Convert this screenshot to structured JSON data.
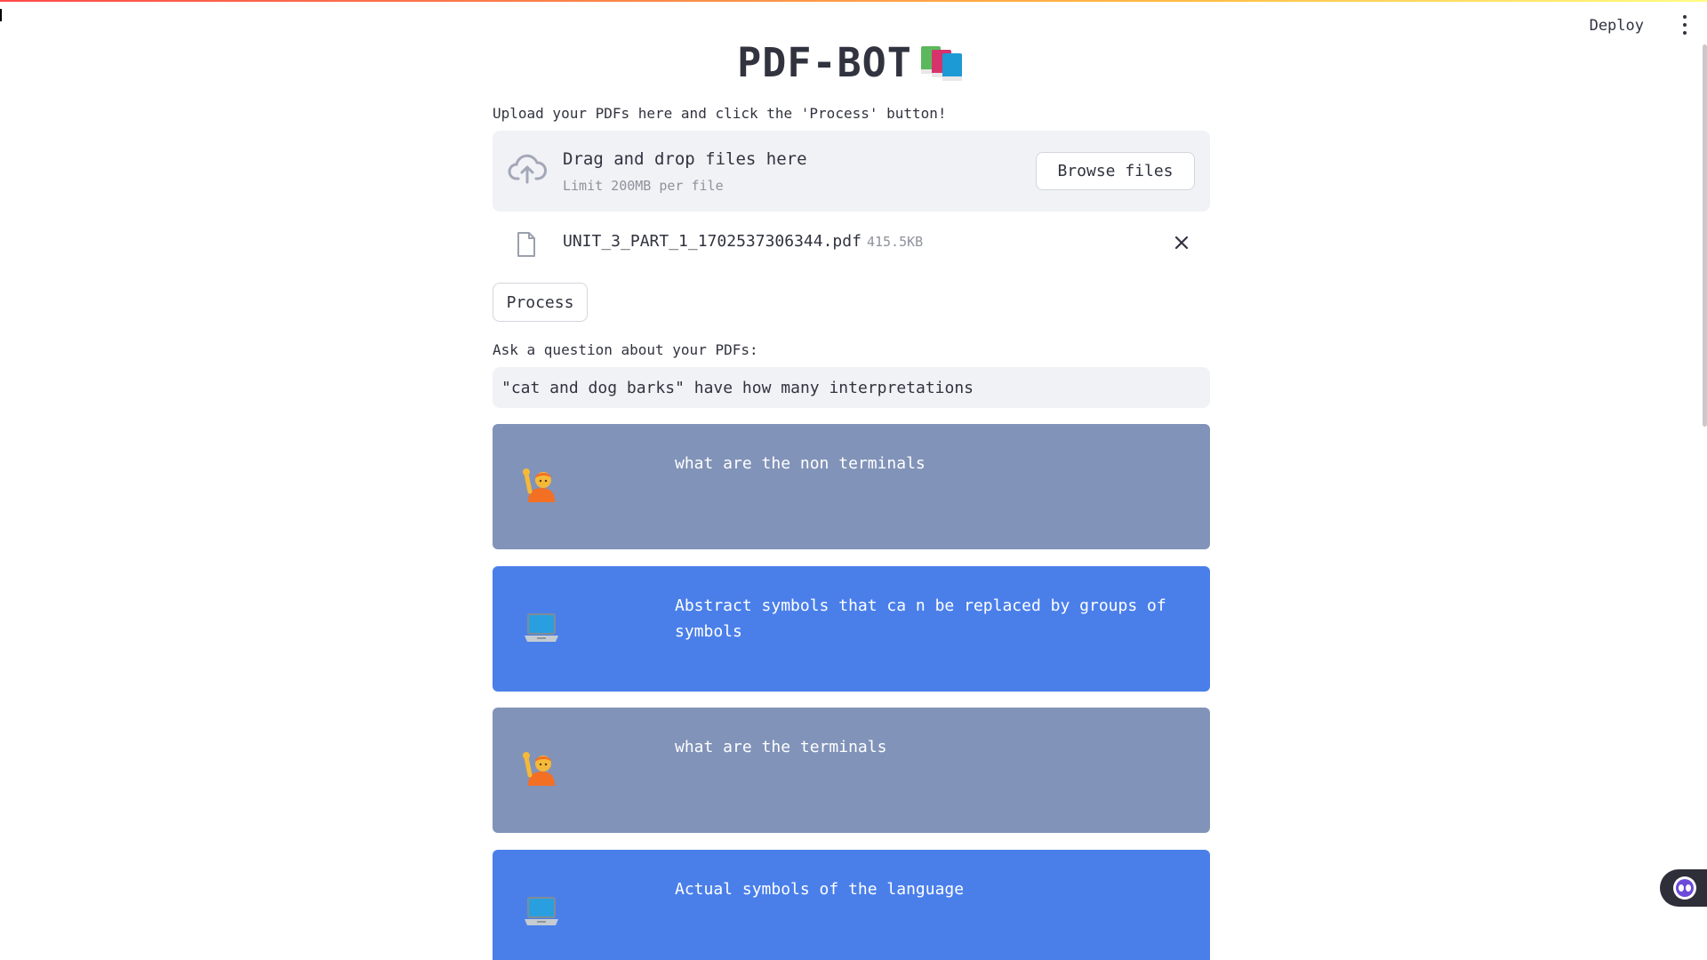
{
  "header": {
    "deploy_label": "Deploy"
  },
  "app": {
    "title": "PDF-BOT",
    "upload_label": "Upload your PDFs here and click the 'Process' button!",
    "dropzone": {
      "title": "Drag and drop files here",
      "limit": "Limit 200MB per file",
      "browse_label": "Browse files"
    },
    "file": {
      "name": "UNIT_3_PART_1_1702537306344.pdf",
      "size": "415.5KB"
    },
    "process_label": "Process",
    "question_label": "Ask a question about your PDFs:",
    "question_value": "\"cat and dog barks\" have how many interpretations"
  },
  "chat": [
    {
      "role": "user",
      "avatar_icon": "person-raising-hand-icon",
      "text": "what are the non terminals"
    },
    {
      "role": "bot",
      "avatar_icon": "laptop-icon",
      "text": "Abstract symbols that ca n be replaced by groups of symbols"
    },
    {
      "role": "user",
      "avatar_icon": "person-raising-hand-icon",
      "text": "what are the terminals"
    },
    {
      "role": "bot",
      "avatar_icon": "laptop-icon",
      "text": "Actual symbols of the language"
    }
  ],
  "colors": {
    "user_bubble": "#8193b8",
    "bot_bubble": "#4a7fea",
    "dropzone_bg": "#f0f2f6",
    "text": "#31333f"
  }
}
